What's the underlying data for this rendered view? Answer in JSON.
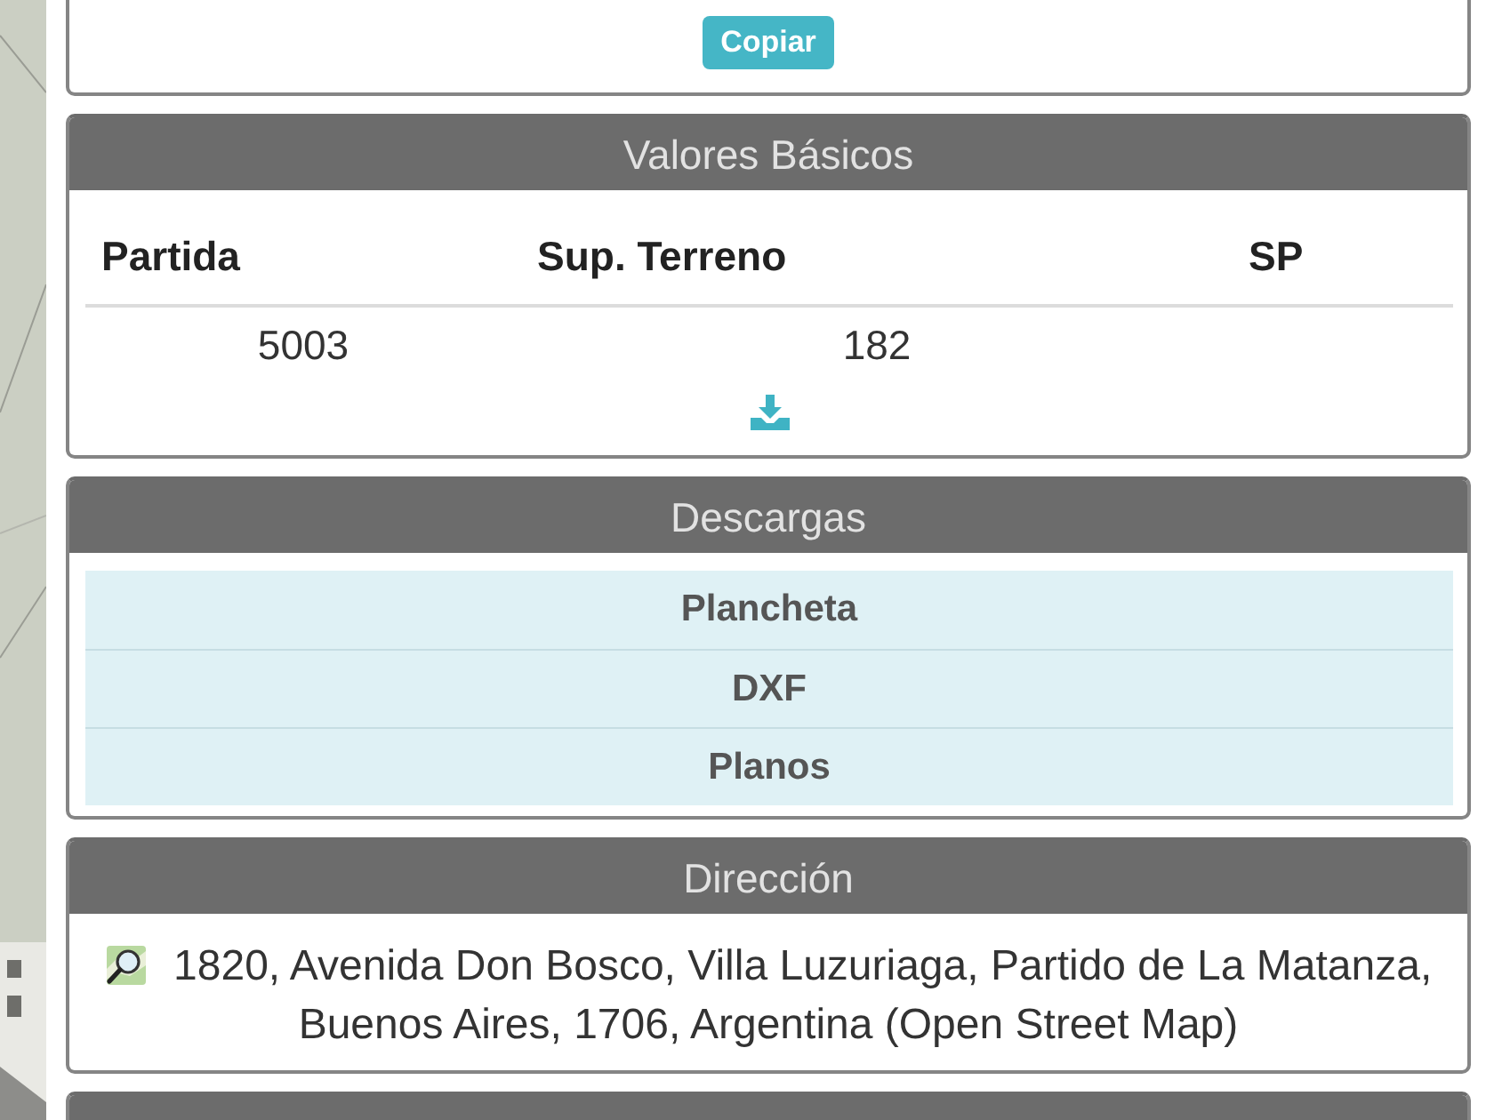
{
  "top_panel": {
    "button": "Copiar"
  },
  "valores_basicos": {
    "title": "Valores Básicos",
    "table": {
      "columns": [
        "Partida",
        "Sup. Terreno",
        "SP"
      ],
      "rows": [
        {
          "cells": [
            "5003",
            "182"
          ]
        }
      ]
    }
  },
  "descargas": {
    "title": "Descargas",
    "items": [
      "Plancheta",
      "DXF",
      "Planos"
    ]
  },
  "direccion": {
    "title": "Dirección",
    "address": "1820, Avenida Don Bosco, Villa Luzuriaga, Partido de La Matanza, Buenos Aires, 1706, Argentina (Open Street Map)"
  }
}
